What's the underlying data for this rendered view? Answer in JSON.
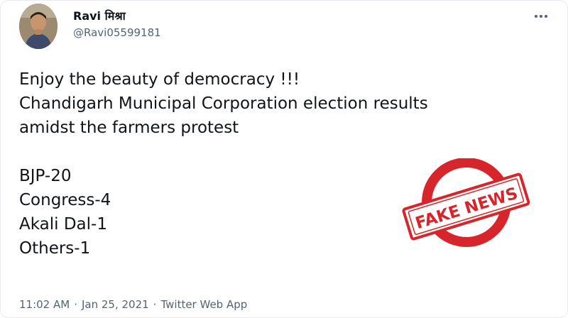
{
  "tweet": {
    "author": {
      "display_name": "Ravi मिश्रा",
      "handle": "@Ravi05599181"
    },
    "text_lines": [
      "Enjoy the beauty of democracy !!!",
      "Chandigarh Municipal Corporation election results",
      "amidst the farmers protest",
      "",
      "BJP-20",
      "Congress-4",
      "Akali Dal-1",
      "Others-1"
    ],
    "time": "11:02 AM",
    "date": "Jan 25, 2021",
    "source": "Twitter Web App",
    "separator": "·"
  },
  "stamp": {
    "text": "FAKE NEWS",
    "color": "#d7262b"
  },
  "icons": {
    "more": "more-horizontal-icon"
  }
}
